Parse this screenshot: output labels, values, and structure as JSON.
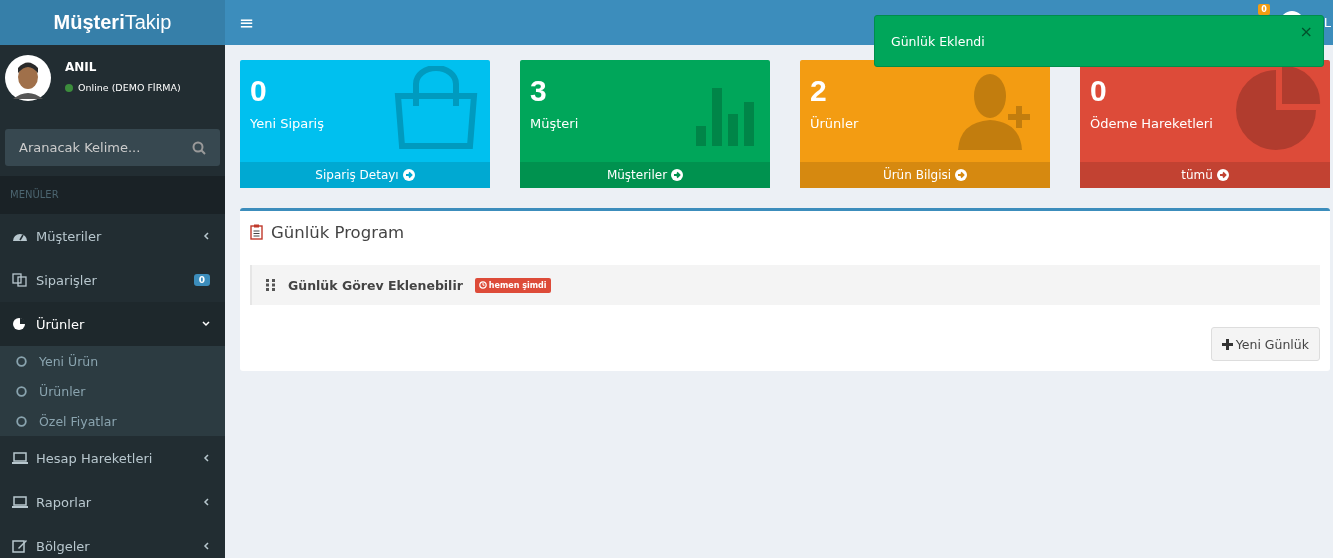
{
  "logo": "**Müşteri**Takip",
  "user": {
    "name": "ANIL",
    "status": "Online (DEMO FİRMA)",
    "online": true
  },
  "search": {
    "placeholder": "Aranacak Kelime..."
  },
  "menu_header": "MENÜLER",
  "menu": [
    {
      "label": "Müşteriler",
      "expanded": false,
      "selected": false
    },
    {
      "label": "Siparişler",
      "badge": "0",
      "selected": false
    },
    {
      "label": "Ürünler",
      "expanded": true,
      "selected": true,
      "children": [
        {
          "label": "Yeni Ürün"
        },
        {
          "label": "Ürünler"
        },
        {
          "label": "Özel Fiyatlar"
        }
      ]
    },
    {
      "label": "Hesap Hareketleri",
      "expanded": false,
      "selected": false
    },
    {
      "label": "Raporlar",
      "expanded": false,
      "selected": false
    },
    {
      "label": "Bölgeler",
      "expanded": false,
      "selected": false
    }
  ],
  "header": {
    "menu_icon": "≡",
    "notification_count": "0",
    "user_name": "L"
  },
  "stats": [
    {
      "value": "0",
      "label": "Yeni Sipariş",
      "link": "Sipariş Detayı",
      "color": "#00c0ef"
    },
    {
      "value": "3",
      "label": "Müşteri",
      "link": "Müşteriler",
      "color": "#00a65a"
    },
    {
      "value": "2",
      "label": "Ürünler",
      "link": "Ürün Bilgisi",
      "color": "#f39c12"
    },
    {
      "value": "0",
      "label": "Ödeme Hareketleri",
      "link": "tümü",
      "color": "#dd4b39"
    }
  ],
  "program": {
    "title": "Günlük Program",
    "tasks": [
      {
        "text": "Günlük Görev Eklenebilir",
        "time": "hemen şimdi"
      }
    ],
    "button": "Yeni Günlük"
  },
  "toast": {
    "message": "Günlük Eklendi",
    "close": "×"
  }
}
